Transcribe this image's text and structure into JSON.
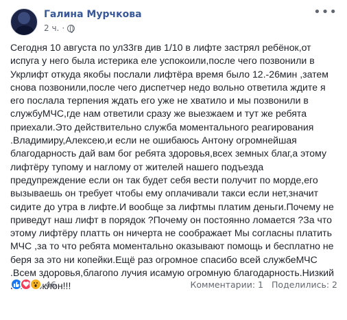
{
  "post": {
    "author": "Галина Мурчкова",
    "time": "2 ч.",
    "privacy_icon": "globe-icon",
    "more_icon": "more-options-icon",
    "lines": [
      "Сегодня 10 августа по ул33гв див 1/10 в лифте застрял ребёнок,от",
      "испуга у него была истерика еле успокоили,после чего позвонили в",
      "Укрлифт откуда якобы послали лифтёра время было 12.-26мин ,затем",
      "снова позвонили,после чего диспетчер недо вольно ответила ждите я",
      "его послала терпения ждать его уже не хватило и мы позвонили в",
      "службуМЧС,где нам ответили сразу же выезжаем и тут же ребята",
      "приехали.Это действительно служба моментального реагирования",
      ".Владимиру,Алексею,и если не ошибаюсь Антону огромнейшая",
      "благодарность дай вам бог ребята здоровья,всех земных благ,а этому",
      "лифтёру тупому и наглому от жителей нашего подъезда",
      "предупреждение если он так будет себя вести получит по морде,его",
      "вызываешь он требует чтобы ему оплачивали такси если нет,значит",
      "сидите до утра в лифте.И вообще за лифтмы платим деньги.Почему не",
      "приведут наш лифт в порядок ?Почему он постоянно ломается ?За что",
      "этому лифтёру платть он ничерта не соображает Мы согласны платить",
      "МЧС ,за то что ребята моментально оказывают помощь и бесплатно не",
      "беря за это ни копейки.Ещё раз огромное спасибо всей службеМЧС",
      ".Всем здоровья,благопо лучия исамую огромную благодарность.Низкий",
      "Вам поклон!!!"
    ]
  },
  "footer": {
    "reaction_icons": [
      "like-icon",
      "love-icon",
      "wow-icon"
    ],
    "reaction_count": "46",
    "comments": "Комментарии: 1",
    "shares": "Поделились: 2"
  }
}
